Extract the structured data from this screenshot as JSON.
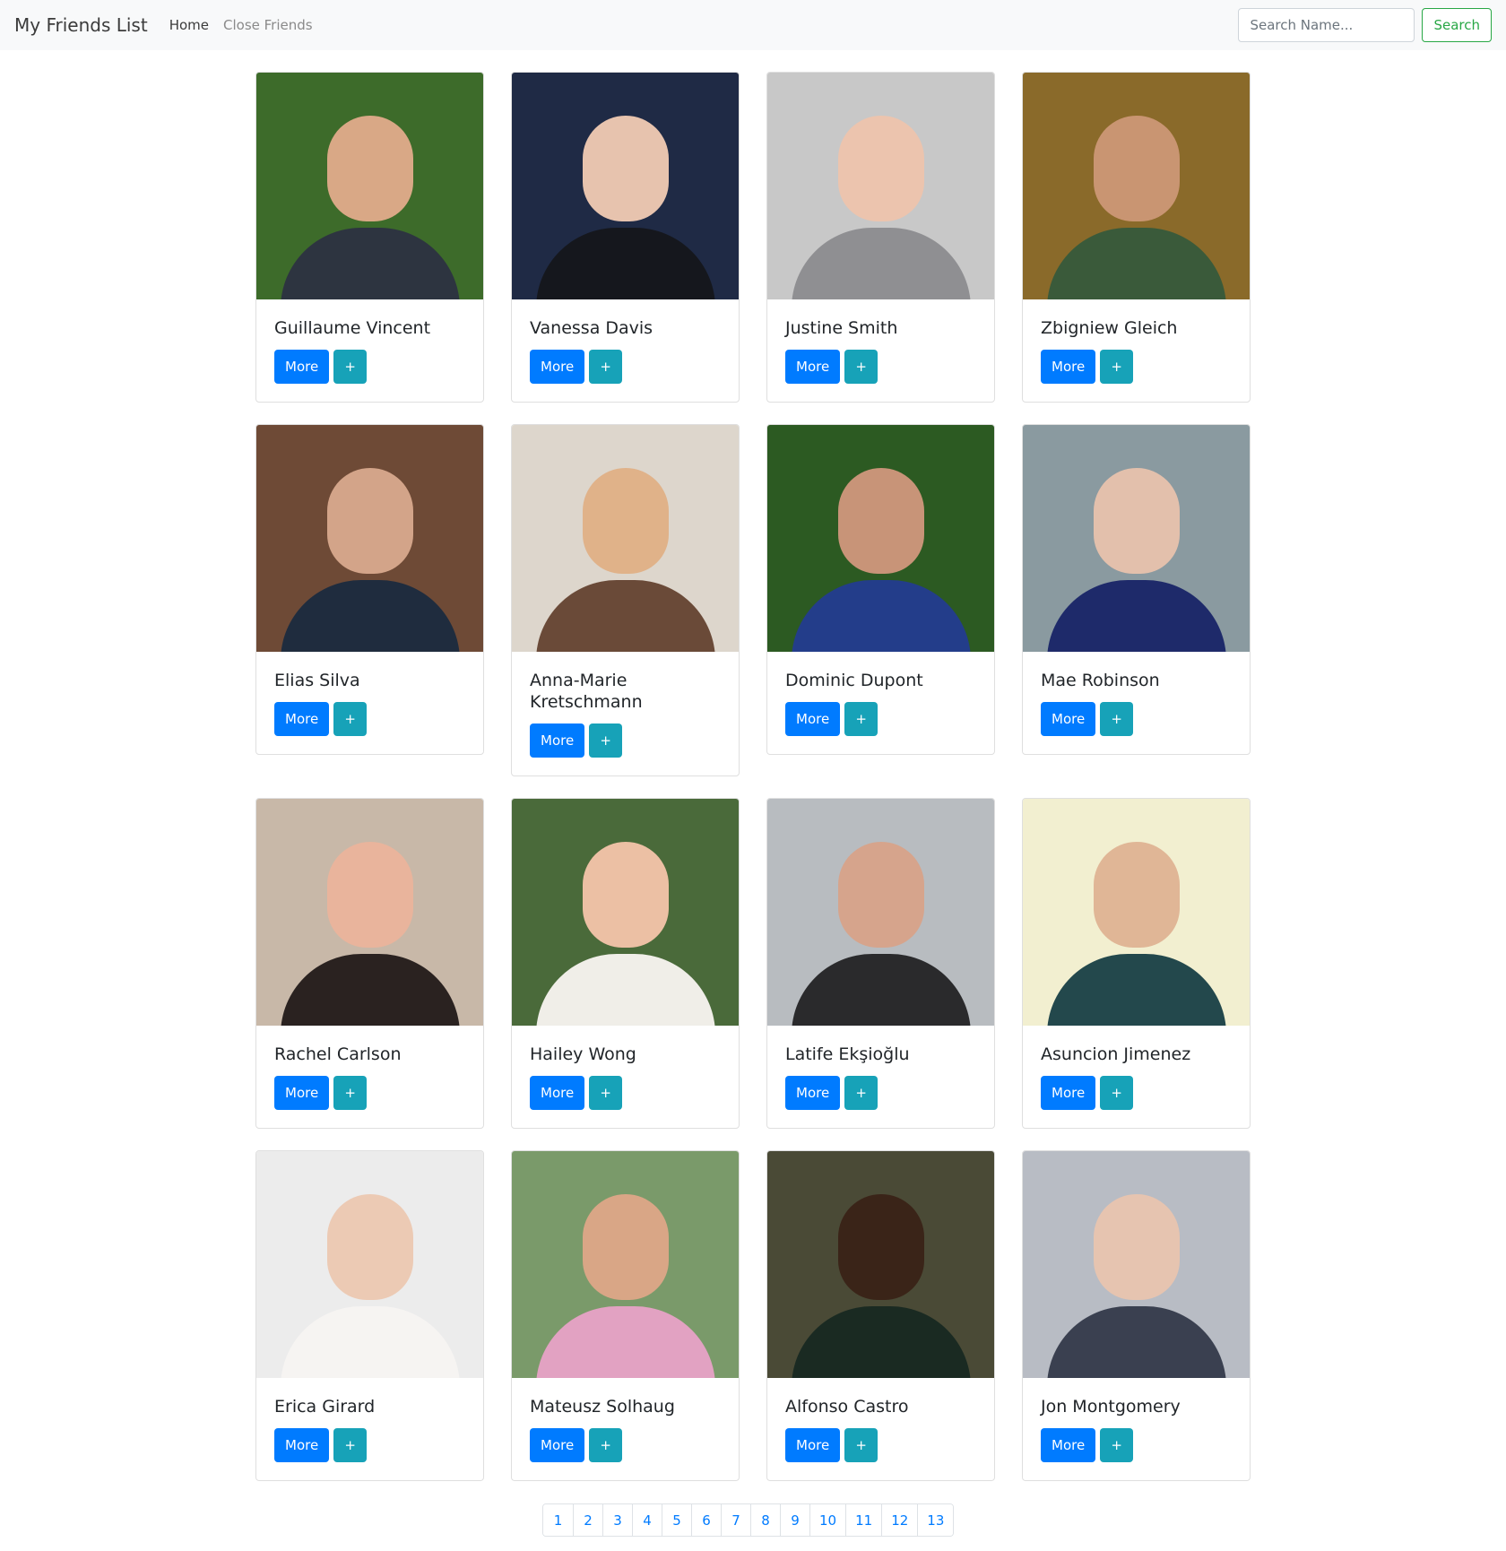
{
  "navbar": {
    "brand": "My Friends List",
    "links": [
      "Home",
      "Close Friends"
    ],
    "search_placeholder": "Search Name...",
    "search_button": "Search"
  },
  "buttons": {
    "more": "More",
    "add": "+"
  },
  "friends": [
    {
      "name": "Guillaume Vincent",
      "bg": "#3d6b2a",
      "skin": "#d9a886",
      "cloth": "#2d3440"
    },
    {
      "name": "Vanessa Davis",
      "bg": "#1f2a45",
      "skin": "#e7c3ae",
      "cloth": "#15171d"
    },
    {
      "name": "Justine Smith",
      "bg": "#c8c8c8",
      "skin": "#ecc4ae",
      "cloth": "#8f8f92"
    },
    {
      "name": "Zbigniew Gleich",
      "bg": "#8a6a2a",
      "skin": "#c99572",
      "cloth": "#3a5a3a"
    },
    {
      "name": "Elias Silva",
      "bg": "#6e4a36",
      "skin": "#d3a489",
      "cloth": "#1f2c3e"
    },
    {
      "name": "Anna-Marie Kretschmann",
      "bg": "#ddd6cc",
      "skin": "#e0b289",
      "cloth": "#6a4a38"
    },
    {
      "name": "Dominic Dupont",
      "bg": "#2c5a22",
      "skin": "#c89478",
      "cloth": "#233d8a"
    },
    {
      "name": "Mae Robinson",
      "bg": "#8a9aa0",
      "skin": "#e3c0ac",
      "cloth": "#1e2a6a"
    },
    {
      "name": "Rachel Carlson",
      "bg": "#c8b8a8",
      "skin": "#e9b49c",
      "cloth": "#2a2220"
    },
    {
      "name": "Hailey Wong",
      "bg": "#4a6a3a",
      "skin": "#ecc0a4",
      "cloth": "#f0eee8"
    },
    {
      "name": "Latife Ekşioğlu",
      "bg": "#b8bcc0",
      "skin": "#d6a48c",
      "cloth": "#2a2a2c"
    },
    {
      "name": "Asuncion Jimenez",
      "bg": "#f2efd0",
      "skin": "#e0b696",
      "cloth": "#23484c"
    },
    {
      "name": "Erica Girard",
      "bg": "#ececec",
      "skin": "#eccab4",
      "cloth": "#f6f4f2"
    },
    {
      "name": "Mateusz Solhaug",
      "bg": "#7a9a6a",
      "skin": "#d9a686",
      "cloth": "#e2a2c2"
    },
    {
      "name": "Alfonso Castro",
      "bg": "#4a4a36",
      "skin": "#3a2418",
      "cloth": "#1a2a22"
    },
    {
      "name": "Jon Montgomery",
      "bg": "#b8bcc4",
      "skin": "#e6c4b0",
      "cloth": "#3a4050"
    }
  ],
  "pagination": [
    "1",
    "2",
    "3",
    "4",
    "5",
    "6",
    "7",
    "8",
    "9",
    "10",
    "11",
    "12",
    "13"
  ]
}
